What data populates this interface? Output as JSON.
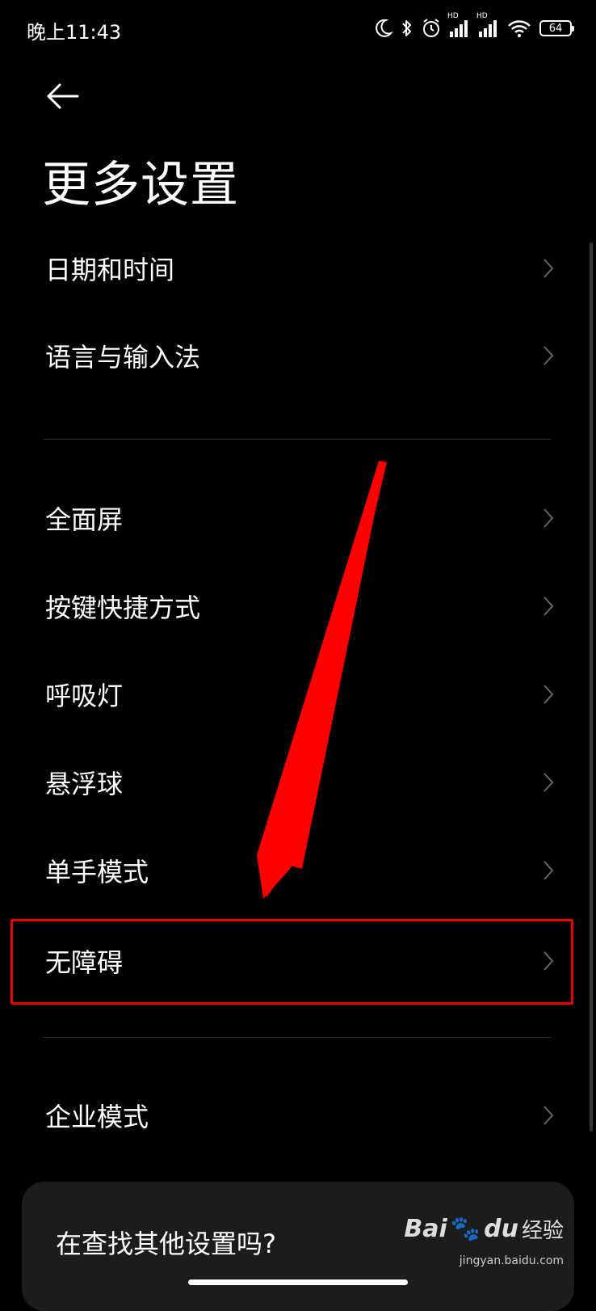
{
  "status_bar": {
    "time": "晚上11:43",
    "hd1": "HD",
    "hd2": "HD",
    "battery": "64",
    "icons": [
      "moon-icon",
      "bluetooth-icon",
      "alarm-icon",
      "signal-icon",
      "signal-icon",
      "wifi-icon",
      "battery-icon"
    ]
  },
  "header": {
    "back_icon": "back-arrow-icon",
    "title": "更多设置"
  },
  "group1": [
    {
      "label": "日期和时间"
    },
    {
      "label": "语言与输入法"
    }
  ],
  "group2": [
    {
      "label": "全面屏"
    },
    {
      "label": "按键快捷方式"
    },
    {
      "label": "呼吸灯"
    },
    {
      "label": "悬浮球"
    },
    {
      "label": "单手模式"
    },
    {
      "label": "无障碍"
    }
  ],
  "group3": [
    {
      "label": "企业模式"
    }
  ],
  "search_card": {
    "text": "在查找其他设置吗?"
  },
  "watermark": {
    "brand": "Bai",
    "paw": "du",
    "name": "经验",
    "url": "jingyan.baidu.com"
  },
  "annotation": {
    "arrow_color": "#ff0000",
    "highlight_color": "#ee0000",
    "highlighted_item": "无障碍"
  },
  "colors": {
    "background": "#000000",
    "card": "#1c1c1e",
    "chevron": "#666666"
  }
}
